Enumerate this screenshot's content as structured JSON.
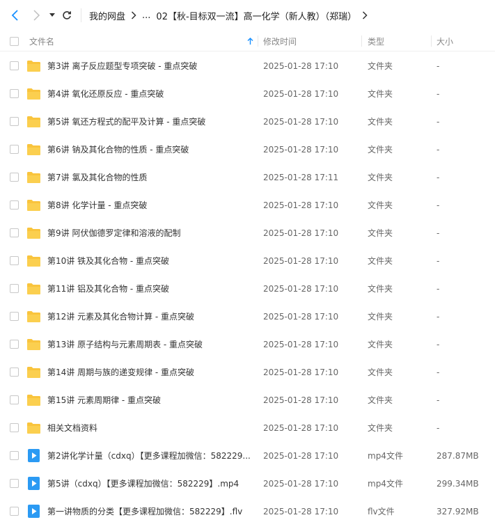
{
  "toolbar": {
    "back_icon": "chevron-left-icon",
    "forward_icon": "chevron-right-icon",
    "history_icon": "caret-down-icon",
    "refresh_icon": "refresh-icon"
  },
  "breadcrumb": {
    "root": "我的网盘",
    "ellipsis": "...",
    "current": "02【秋-目标双一流】高一化学（新人教）（郑瑞）"
  },
  "header": {
    "name": "文件名",
    "modified": "修改时间",
    "type": "类型",
    "size": "大小",
    "sort_icon": "sort-arrow-up-icon"
  },
  "colors": {
    "folder": "#f9c43d",
    "video": "#2b9af3",
    "accent": "#1890ff"
  },
  "files": [
    {
      "name": "第3讲 离子反应题型专项突破 - 重点突破",
      "modified": "2025-01-28 17:10",
      "type": "文件夹",
      "size": "-",
      "icon": "folder-icon"
    },
    {
      "name": "第4讲 氧化还原反应 - 重点突破",
      "modified": "2025-01-28 17:10",
      "type": "文件夹",
      "size": "-",
      "icon": "folder-icon"
    },
    {
      "name": "第5讲 氧还方程式的配平及计算 - 重点突破",
      "modified": "2025-01-28 17:10",
      "type": "文件夹",
      "size": "-",
      "icon": "folder-icon"
    },
    {
      "name": "第6讲 钠及其化合物的性质 - 重点突破",
      "modified": "2025-01-28 17:10",
      "type": "文件夹",
      "size": "-",
      "icon": "folder-icon"
    },
    {
      "name": "第7讲 氯及其化合物的性质",
      "modified": "2025-01-28 17:11",
      "type": "文件夹",
      "size": "-",
      "icon": "folder-icon"
    },
    {
      "name": "第8讲 化学计量 - 重点突破",
      "modified": "2025-01-28 17:10",
      "type": "文件夹",
      "size": "-",
      "icon": "folder-icon"
    },
    {
      "name": "第9讲 阿伏伽德罗定律和溶液的配制",
      "modified": "2025-01-28 17:10",
      "type": "文件夹",
      "size": "-",
      "icon": "folder-icon"
    },
    {
      "name": "第10讲 铁及其化合物 - 重点突破",
      "modified": "2025-01-28 17:10",
      "type": "文件夹",
      "size": "-",
      "icon": "folder-icon"
    },
    {
      "name": "第11讲 铝及其化合物 - 重点突破",
      "modified": "2025-01-28 17:10",
      "type": "文件夹",
      "size": "-",
      "icon": "folder-icon"
    },
    {
      "name": "第12讲 元素及其化合物计算 - 重点突破",
      "modified": "2025-01-28 17:10",
      "type": "文件夹",
      "size": "-",
      "icon": "folder-icon"
    },
    {
      "name": "第13讲 原子结构与元素周期表 - 重点突破",
      "modified": "2025-01-28 17:10",
      "type": "文件夹",
      "size": "-",
      "icon": "folder-icon"
    },
    {
      "name": "第14讲 周期与族的递变规律 - 重点突破",
      "modified": "2025-01-28 17:10",
      "type": "文件夹",
      "size": "-",
      "icon": "folder-icon"
    },
    {
      "name": "第15讲 元素周期律 - 重点突破",
      "modified": "2025-01-28 17:10",
      "type": "文件夹",
      "size": "-",
      "icon": "folder-icon"
    },
    {
      "name": "相关文档资料",
      "modified": "2025-01-28 17:10",
      "type": "文件夹",
      "size": "-",
      "icon": "folder-icon"
    },
    {
      "name": "第2讲化学计量（cdxq）【更多课程加微信：582229...",
      "modified": "2025-01-28 17:10",
      "type": "mp4文件",
      "size": "287.87MB",
      "icon": "video-file-icon"
    },
    {
      "name": "第5讲（cdxq）【更多课程加微信：582229】.mp4",
      "modified": "2025-01-28 17:10",
      "type": "mp4文件",
      "size": "299.34MB",
      "icon": "video-file-icon"
    },
    {
      "name": "第一讲物质的分类【更多课程加微信：582229】.flv",
      "modified": "2025-01-28 17:10",
      "type": "flv文件",
      "size": "327.92MB",
      "icon": "video-file-icon"
    }
  ]
}
